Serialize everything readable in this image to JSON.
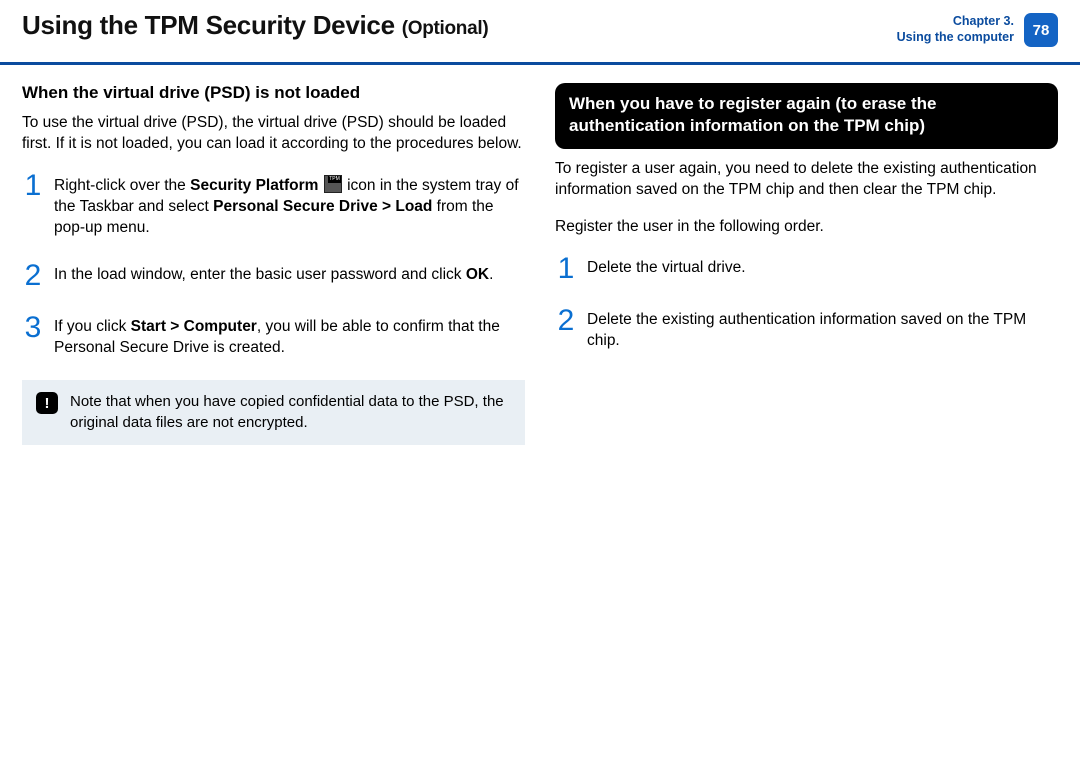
{
  "header": {
    "title_main": "Using the TPM Security Device",
    "title_suffix": "(Optional)",
    "chapter_line1": "Chapter 3.",
    "chapter_line2": "Using the computer",
    "page_number": "78"
  },
  "left": {
    "subtitle": "When the virtual drive (PSD) is not loaded",
    "intro": "To use the virtual drive (PSD), the virtual drive (PSD) should be loaded first. If it is not loaded, you can load it according to the procedures below.",
    "steps": [
      {
        "num": "1",
        "pre": "Right-click over the ",
        "bold1": "Security Platform",
        "mid1": " ",
        "mid2": " icon in the system tray of the Taskbar and select ",
        "bold2": "Personal Secure Drive > Load",
        "post": " from the pop-up menu."
      },
      {
        "num": "2",
        "pre": "In the load window, enter the basic user password and click ",
        "bold1": "OK",
        "post": "."
      },
      {
        "num": "3",
        "pre": "If you click ",
        "bold1": "Start > Computer",
        "post": ", you will be able to confirm that the Personal Secure Drive is created."
      }
    ],
    "note_icon": "!",
    "note": "Note that when you have copied confidential data to the PSD, the original data files are not encrypted."
  },
  "right": {
    "callout": "When you have to register again (to erase the authentication information on the TPM chip)",
    "intro": "To register a user again, you need to delete the existing authentication information saved on the TPM chip and then clear the TPM chip.",
    "subtext": "Register the user in the following order.",
    "steps": [
      {
        "num": "1",
        "text": "Delete the virtual drive."
      },
      {
        "num": "2",
        "text": "Delete the existing authentication information saved on the TPM chip."
      }
    ]
  }
}
